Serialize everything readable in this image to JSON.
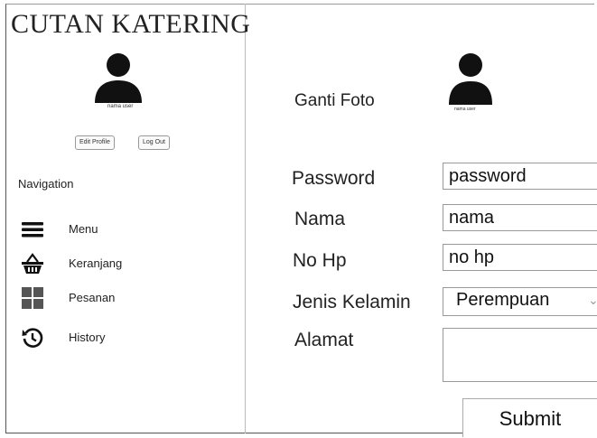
{
  "app": {
    "brand": "CUTAN KATERING"
  },
  "sidebar": {
    "avatar_caption": "nama user",
    "edit_profile_label": "Edit Profile",
    "logout_label": "Log Out",
    "nav_heading": "Navigation",
    "items": [
      {
        "label": "Menu",
        "icon": "menu-icon"
      },
      {
        "label": "Keranjang",
        "icon": "basket-icon"
      },
      {
        "label": "Pesanan",
        "icon": "grid-icon"
      },
      {
        "label": "History",
        "icon": "history-icon"
      }
    ]
  },
  "main": {
    "avatar_caption": "nama user",
    "change_photo_label": "Ganti Foto",
    "form": {
      "password_label": "Password",
      "password_value": "password",
      "name_label": "Nama",
      "name_value": "nama",
      "phone_label": "No Hp",
      "phone_value": "no hp",
      "gender_label": "Jenis Kelamin",
      "gender_value": "Perempuan",
      "address_label": "Alamat",
      "address_value": "",
      "submit_label": "Submit"
    }
  }
}
